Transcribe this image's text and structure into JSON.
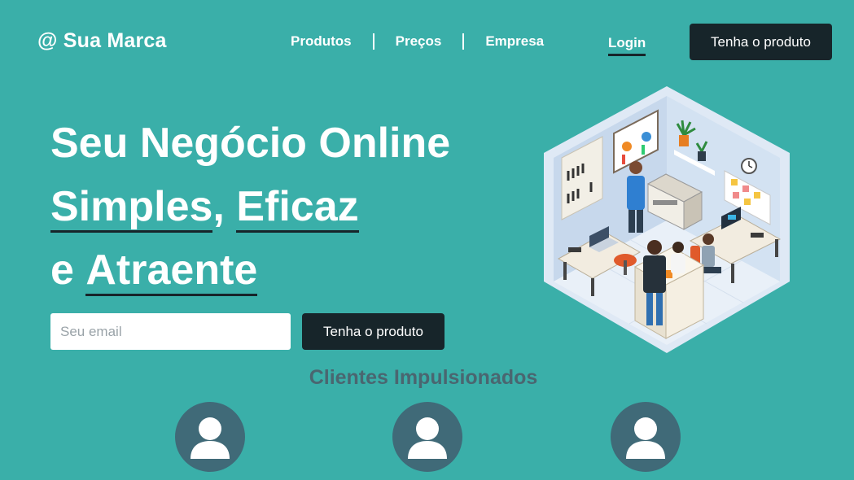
{
  "header": {
    "brand": "@ Sua Marca",
    "nav": [
      {
        "label": "Produtos"
      },
      {
        "label": "Preços"
      },
      {
        "label": "Empresa"
      }
    ],
    "login": "Login",
    "cta": "Tenha o produto"
  },
  "hero": {
    "line1": "Seu Negócio Online",
    "word_simples": "Simples",
    "comma": ",",
    "word_eficaz": "Eficaz",
    "connector": "e",
    "word_atraente": "Atraente",
    "email_placeholder": "Seu email",
    "email_value": "",
    "cta": "Tenha o produto"
  },
  "clients": {
    "title": "Clientes Impulsionados",
    "avatars": [
      {
        "icon": "user-icon"
      },
      {
        "icon": "user-icon"
      },
      {
        "icon": "user-icon"
      }
    ]
  },
  "colors": {
    "background": "#3aafa9",
    "dark": "#17252a",
    "avatar": "#406a78",
    "section_title": "#4a6670"
  }
}
